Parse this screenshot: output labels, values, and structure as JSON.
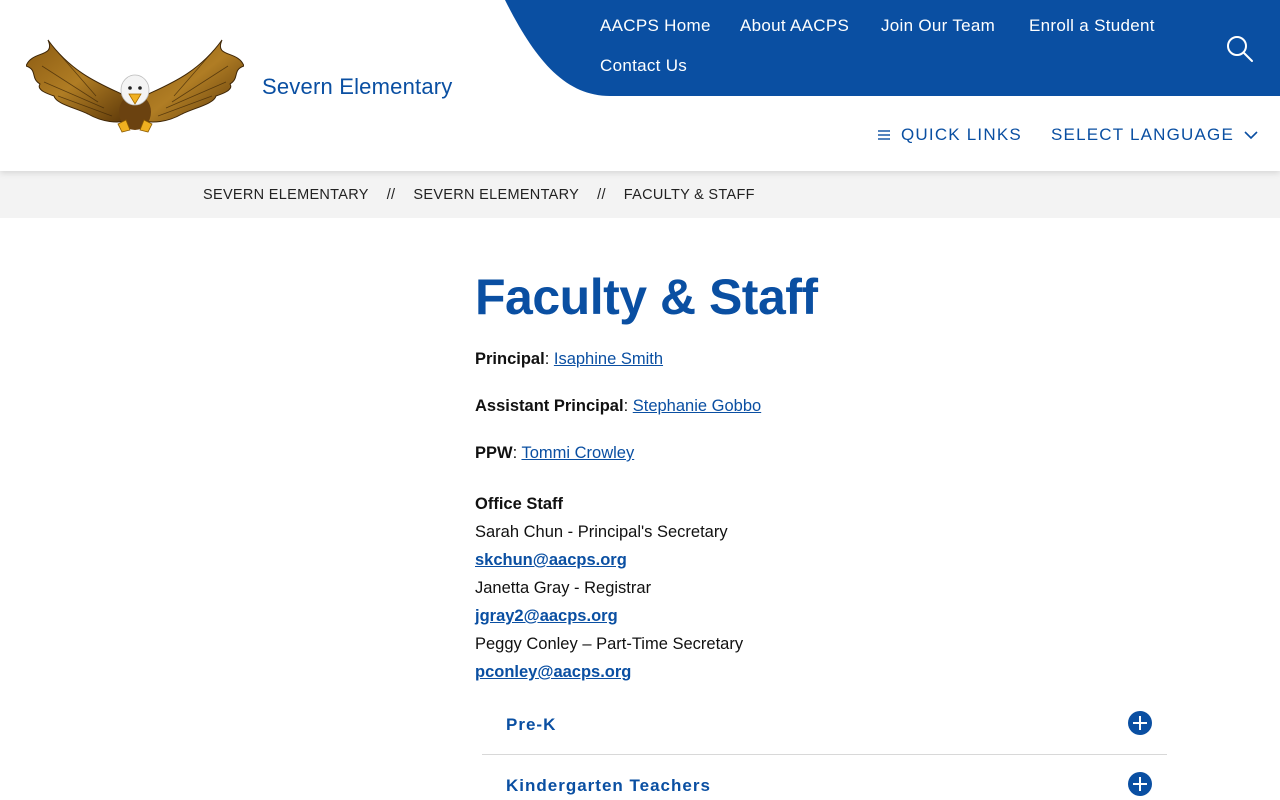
{
  "header": {
    "school_name": "Severn Elementary",
    "nav": [
      {
        "label": "AACPS Home"
      },
      {
        "label": "About AACPS"
      },
      {
        "label": "Join Our Team"
      },
      {
        "label": "Enroll a Student"
      },
      {
        "label": "Contact Us"
      }
    ],
    "quick_links_label": "Quick Links",
    "select_language_label": "Select Language",
    "icons": {
      "logo": "eagle-logo",
      "search": "search-icon",
      "menu": "menu-lines-icon",
      "chevron": "chevron-down-icon"
    },
    "colors": {
      "brand_blue": "#0a4fa2",
      "breadcrumb_bg": "#f3f3f3"
    }
  },
  "breadcrumb": {
    "items": [
      "Severn Elementary",
      "Severn Elementary",
      "Faculty & Staff"
    ],
    "separator": "//"
  },
  "main": {
    "title": "Faculty & Staff",
    "principal": {
      "label": "Principal",
      "name": "Isaphine Smith"
    },
    "assistant_principal": {
      "label": "Assistant Principal",
      "name": "Stephanie Gobbo"
    },
    "ppw": {
      "label": "PPW",
      "name": "Tommi Crowley"
    },
    "office_staff": {
      "heading": "Office Staff",
      "members": [
        {
          "text": "Sarah Chun - Principal's Secretary",
          "email": "skchun@aacps.org"
        },
        {
          "text": "Janetta Gray - Registrar",
          "email": "jgray2@aacps.org"
        },
        {
          "text": "Peggy Conley – Part-Time Secretary",
          "email": "pconley@aacps.org"
        }
      ]
    },
    "accordions": [
      {
        "label": "Pre-K"
      },
      {
        "label": "Kindergarten Teachers"
      }
    ]
  }
}
